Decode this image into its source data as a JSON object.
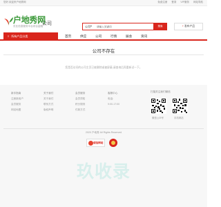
{
  "topbar": {
    "welcome": "您好,欢迎来户地秀网",
    "links": [
      "免费注册",
      "登录",
      "VIP服务",
      "网站导航"
    ]
  },
  "brand": {
    "name": "户地秀网",
    "suffix": "公司",
    "slogan": "农业信息服务平台综合金融"
  },
  "search": {
    "scope": "公司",
    "placeholder": "请输入关键词",
    "button": "搜索"
  },
  "publish": {
    "label": "发布产品"
  },
  "nav": {
    "category": "所有产品分类",
    "items": [
      "首页",
      "供应",
      "公司",
      "行情",
      "展会",
      "资讯"
    ]
  },
  "main": {
    "title": "公司不存在",
    "message": "您是否访问的公司主页已被删除或被屏蔽,请查询后再重新试一下。"
  },
  "footer": {
    "columns": [
      {
        "head": "新手指南",
        "items": [
          "注册新用户",
          "会员服务",
          "网站地图"
        ]
      },
      {
        "head": "关于我们",
        "items": [
          "关于我们",
          "联系方式",
          "版权声明"
        ]
      },
      {
        "head": "会员服务",
        "items": [
          "会员须知",
          "积分规则",
          "付款方式"
        ]
      },
      {
        "head": "客服中心",
        "items": [
          "电话:",
          "9:00-17:00"
        ]
      }
    ],
    "qr_title": "扫描关注我们微信",
    "qr_captions": [
      "微信公众号",
      "手机网站"
    ],
    "copyright": "2020 户地秀 All Rights Reserved",
    "badge_label": "诚信网站"
  },
  "watermark": "玖收录",
  "colors": {
    "accent": "#d9251c",
    "brand_green": "#3d9a3b"
  }
}
